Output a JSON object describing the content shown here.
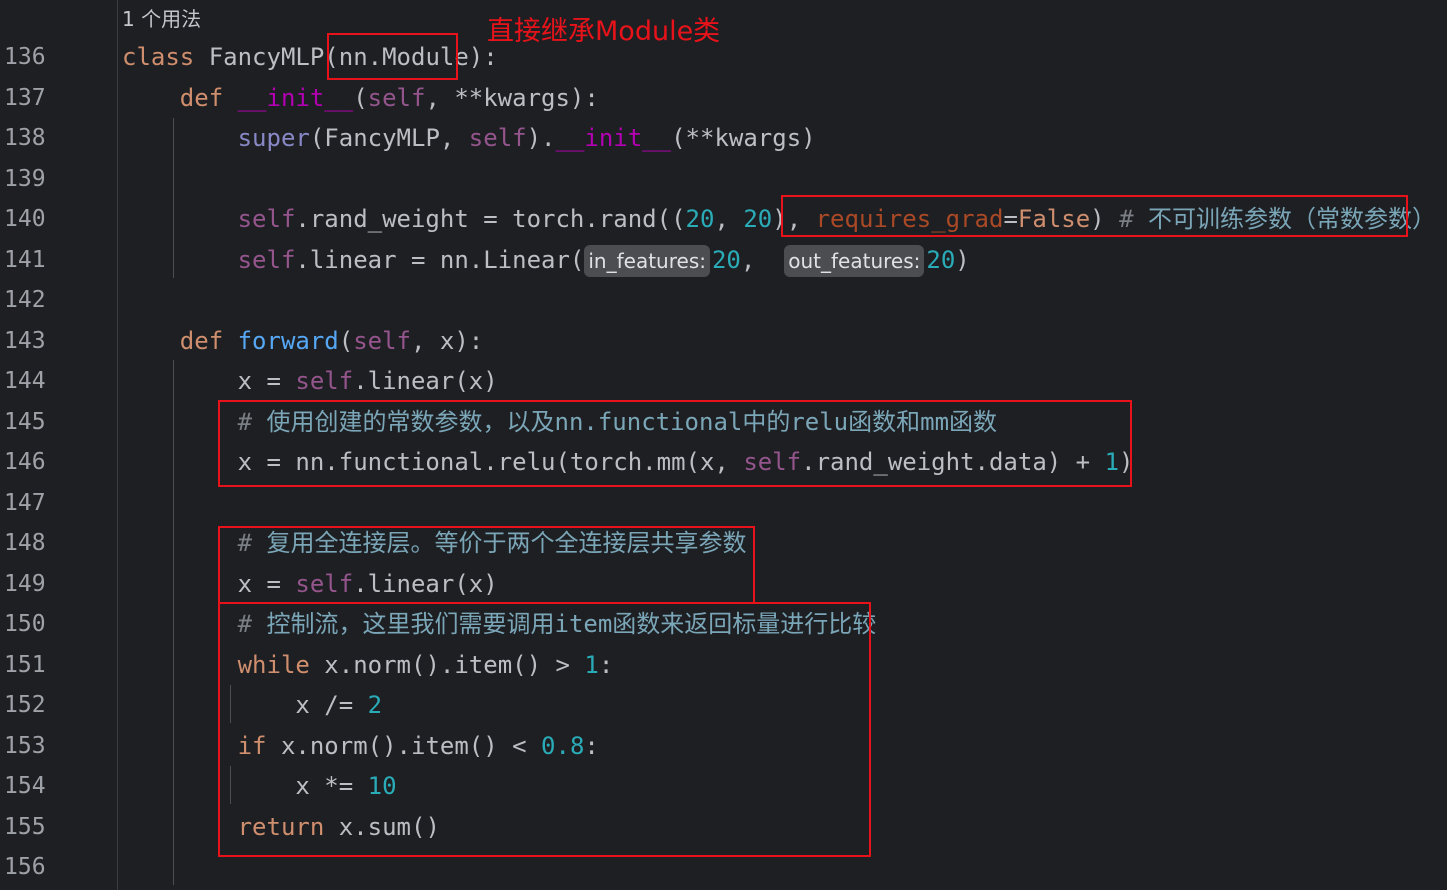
{
  "usage_hint": "1 个用法",
  "annotation": "直接继承Module类",
  "lines": [
    {
      "n": "136",
      "tokens": [
        {
          "t": "class ",
          "c": "kw"
        },
        {
          "t": "FancyMLP(",
          "c": ""
        },
        {
          "t": "nn.Module",
          "c": ""
        },
        {
          "t": "):",
          "c": ""
        }
      ]
    },
    {
      "n": "137",
      "tokens": [
        {
          "t": "    "
        },
        {
          "t": "def ",
          "c": "kw"
        },
        {
          "t": "__init__",
          "c": "dunder"
        },
        {
          "t": "(",
          "c": ""
        },
        {
          "t": "self",
          "c": "self"
        },
        {
          "t": ", **kwargs):",
          "c": ""
        }
      ]
    },
    {
      "n": "138",
      "tokens": [
        {
          "t": "        "
        },
        {
          "t": "super",
          "c": "builtin"
        },
        {
          "t": "(FancyMLP, ",
          "c": ""
        },
        {
          "t": "self",
          "c": "self"
        },
        {
          "t": ").",
          "c": ""
        },
        {
          "t": "__init__",
          "c": "dunder"
        },
        {
          "t": "(**kwargs)",
          "c": ""
        }
      ]
    },
    {
      "n": "139",
      "tokens": []
    },
    {
      "n": "140",
      "tokens": [
        {
          "t": "        "
        },
        {
          "t": "self",
          "c": "self"
        },
        {
          "t": ".rand_weight = torch.rand((",
          "c": ""
        },
        {
          "t": "20",
          "c": "num"
        },
        {
          "t": ", ",
          "c": ""
        },
        {
          "t": "20",
          "c": "num"
        },
        {
          "t": "), ",
          "c": ""
        },
        {
          "t": "requires_grad",
          "c": "param"
        },
        {
          "t": "=",
          "c": ""
        },
        {
          "t": "False",
          "c": "kw"
        },
        {
          "t": ") ",
          "c": ""
        },
        {
          "t": "# ",
          "c": "cmt"
        },
        {
          "t": "不可训练参数（常数参数）",
          "c": "cmt-cn"
        }
      ]
    },
    {
      "n": "141",
      "tokens": [
        {
          "t": "        "
        },
        {
          "t": "self",
          "c": "self"
        },
        {
          "t": ".linear = nn.Linear(",
          "c": ""
        },
        {
          "t": "in_features:",
          "c": "hint"
        },
        {
          "t": "20",
          "c": "num"
        },
        {
          "t": ",  ",
          "c": ""
        },
        {
          "t": "out_features:",
          "c": "hint"
        },
        {
          "t": "20",
          "c": "num"
        },
        {
          "t": ")",
          "c": ""
        }
      ]
    },
    {
      "n": "142",
      "tokens": []
    },
    {
      "n": "143",
      "tokens": [
        {
          "t": "    "
        },
        {
          "t": "def ",
          "c": "kw"
        },
        {
          "t": "forward",
          "c": "fn"
        },
        {
          "t": "(",
          "c": ""
        },
        {
          "t": "self",
          "c": "self"
        },
        {
          "t": ", x):",
          "c": ""
        }
      ]
    },
    {
      "n": "144",
      "tokens": [
        {
          "t": "        "
        },
        {
          "t": "x = ",
          "c": ""
        },
        {
          "t": "self",
          "c": "self"
        },
        {
          "t": ".linear(x)",
          "c": ""
        }
      ]
    },
    {
      "n": "145",
      "tokens": [
        {
          "t": "        "
        },
        {
          "t": "# ",
          "c": "cmt"
        },
        {
          "t": "使用创建的常数参数，以及nn.functional中的relu函数和mm函数",
          "c": "cmt-cn"
        }
      ]
    },
    {
      "n": "146",
      "tokens": [
        {
          "t": "        "
        },
        {
          "t": "x = nn.functional.relu(torch.mm(x, ",
          "c": ""
        },
        {
          "t": "self",
          "c": "self"
        },
        {
          "t": ".rand_weight.data) + ",
          "c": ""
        },
        {
          "t": "1",
          "c": "num"
        },
        {
          "t": ")",
          "c": ""
        }
      ]
    },
    {
      "n": "147",
      "tokens": []
    },
    {
      "n": "148",
      "tokens": [
        {
          "t": "        "
        },
        {
          "t": "# ",
          "c": "cmt"
        },
        {
          "t": "复用全连接层。等价于两个全连接层共享参数",
          "c": "cmt-cn"
        }
      ]
    },
    {
      "n": "149",
      "tokens": [
        {
          "t": "        "
        },
        {
          "t": "x = ",
          "c": ""
        },
        {
          "t": "self",
          "c": "self"
        },
        {
          "t": ".linear(x)",
          "c": ""
        }
      ]
    },
    {
      "n": "150",
      "tokens": [
        {
          "t": "        "
        },
        {
          "t": "# ",
          "c": "cmt"
        },
        {
          "t": "控制流，这里我们需要调用item函数来返回标量进行比较",
          "c": "cmt-cn"
        }
      ]
    },
    {
      "n": "151",
      "tokens": [
        {
          "t": "        "
        },
        {
          "t": "while ",
          "c": "kw"
        },
        {
          "t": "x.norm().item() > ",
          "c": ""
        },
        {
          "t": "1",
          "c": "num"
        },
        {
          "t": ":",
          "c": ""
        }
      ]
    },
    {
      "n": "152",
      "tokens": [
        {
          "t": "            "
        },
        {
          "t": "x /= ",
          "c": ""
        },
        {
          "t": "2",
          "c": "num"
        }
      ]
    },
    {
      "n": "153",
      "tokens": [
        {
          "t": "        "
        },
        {
          "t": "if ",
          "c": "kw"
        },
        {
          "t": "x.norm().item() < ",
          "c": ""
        },
        {
          "t": "0.8",
          "c": "num"
        },
        {
          "t": ":",
          "c": ""
        }
      ]
    },
    {
      "n": "154",
      "tokens": [
        {
          "t": "            "
        },
        {
          "t": "x *= ",
          "c": ""
        },
        {
          "t": "10",
          "c": "num"
        }
      ]
    },
    {
      "n": "155",
      "tokens": [
        {
          "t": "        "
        },
        {
          "t": "return ",
          "c": "kw"
        },
        {
          "t": "x.sum()",
          "c": ""
        }
      ]
    },
    {
      "n": "156",
      "tokens": []
    }
  ]
}
